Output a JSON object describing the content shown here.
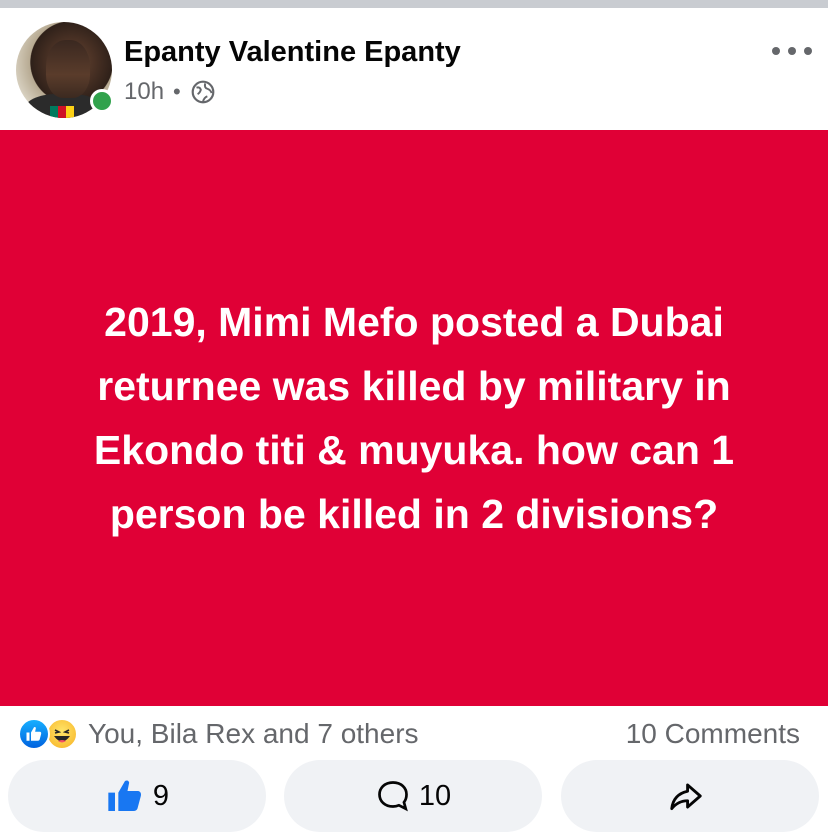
{
  "post": {
    "author": "Epanty Valentine Epanty",
    "time": "10h",
    "separator": "•",
    "text": "2019, Mimi Mefo posted a Dubai returnee was killed by military in Ekondo titi & muyuka. how can 1 person be killed in 2 divisions?",
    "background_color": "#e00036"
  },
  "reactions": {
    "summary": "You, Bila Rex and 7 others",
    "comments": "10 Comments"
  },
  "actions": {
    "like_count": "9",
    "comment_count": "10"
  },
  "icons": [
    "more-icon",
    "globe-icon",
    "like-icon",
    "haha-icon",
    "thumb-up-icon",
    "comment-icon",
    "share-icon"
  ]
}
